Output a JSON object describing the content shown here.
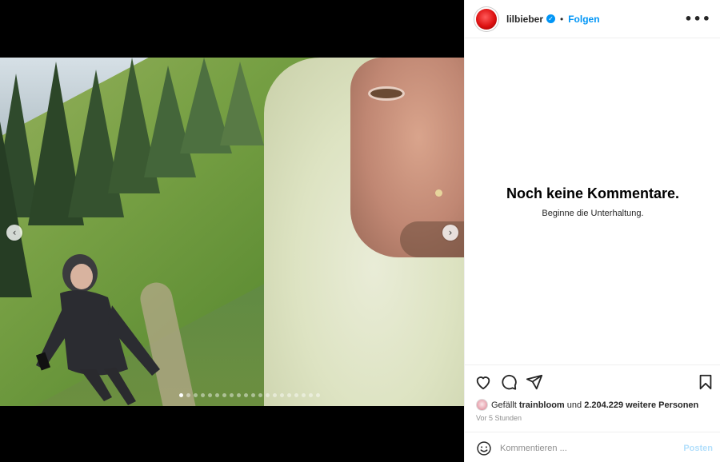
{
  "post": {
    "username": "lilbieber",
    "verified": true,
    "separator": "•",
    "follow_label": "Folgen",
    "more_label": "•••"
  },
  "comments": {
    "empty_title": "Noch keine Kommentare.",
    "empty_subtitle": "Beginne die Unterhaltung."
  },
  "likes": {
    "prefix": "Gefällt",
    "liked_by": "trainbloom",
    "conjunction": "und",
    "count_text": "2.204.229 weitere Personen"
  },
  "timestamp": "Vor 5 Stunden",
  "comment_box": {
    "placeholder": "Kommentieren ...",
    "post_label": "Posten"
  },
  "carousel": {
    "prev_label": "‹",
    "next_label": "›",
    "slide_count": 20,
    "active_index": 0
  },
  "icons": {
    "like": "heart-icon",
    "comment": "comment-icon",
    "share": "send-icon",
    "save": "bookmark-icon",
    "emoji": "emoji-icon",
    "more": "more-options-icon"
  },
  "colors": {
    "link": "#0095f6",
    "post_disabled": "#b2dffc",
    "muted": "#8e8e8e"
  }
}
